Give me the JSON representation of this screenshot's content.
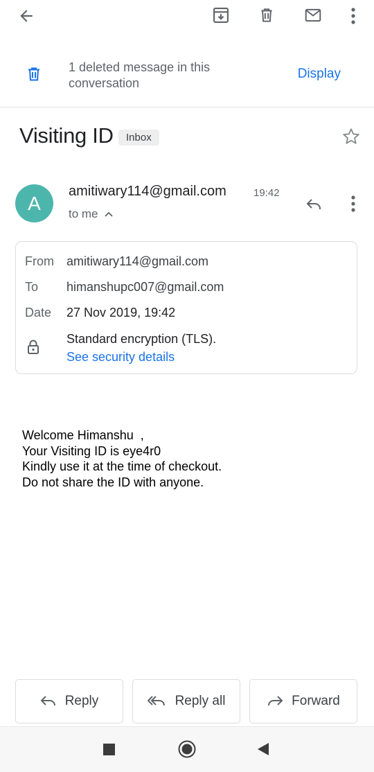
{
  "toolbar": {
    "back_icon": "arrow-left-icon",
    "archive_icon": "archive-icon",
    "delete_icon": "trash-icon",
    "mark_unread_icon": "mail-icon",
    "more_icon": "more-vert-icon"
  },
  "banner": {
    "icon": "trash-icon",
    "text": "1 deleted message in this conversation",
    "action_label": "Display"
  },
  "subject": {
    "title": "Visiting ID",
    "label": "Inbox",
    "star_icon": "star-outline-icon"
  },
  "message": {
    "avatar_letter": "A",
    "sender": "amitiwary114@gmail.com",
    "time": "19:42",
    "to_line": "to me",
    "details": {
      "from_label": "From",
      "from_value": "amitiwary114@gmail.com",
      "to_label": "To",
      "to_value": "himanshupc007@gmail.com",
      "date_label": "Date",
      "date_value": "27 Nov 2019, 19:42",
      "encryption_text": "Standard encryption (TLS).",
      "security_link": "See security details"
    },
    "body_lines": [
      "Welcome Himanshu  ,",
      "Your Visiting ID is eye4r0",
      "Kindly use it at the time of checkout.",
      "Do not share the ID with anyone."
    ]
  },
  "actions": {
    "reply": "Reply",
    "reply_all": "Reply all",
    "forward": "Forward"
  },
  "colors": {
    "accent": "#1a73e8",
    "avatar": "#4db6ac"
  }
}
